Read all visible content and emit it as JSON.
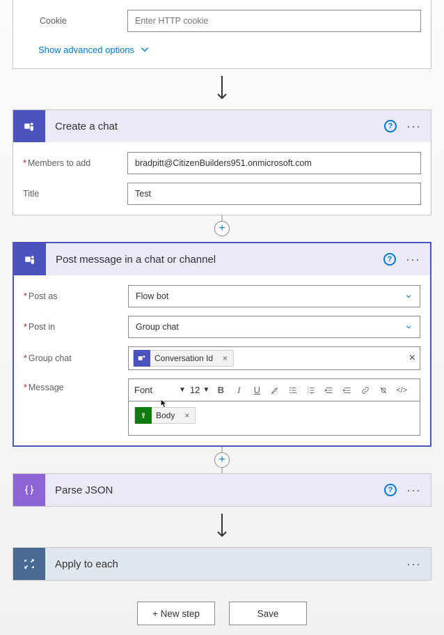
{
  "http_card": {
    "cookie_label": "Cookie",
    "cookie_placeholder": "Enter HTTP cookie",
    "advanced_link": "Show advanced options"
  },
  "create_chat": {
    "title": "Create a chat",
    "members_label": "Members to add",
    "members_value": "bradpitt@CitizenBuilders951.onmicrosoft.com",
    "title_label": "Title",
    "title_value": "Test"
  },
  "post_message": {
    "title": "Post message in a chat or channel",
    "post_as_label": "Post as",
    "post_as_value": "Flow bot",
    "post_in_label": "Post in",
    "post_in_value": "Group chat",
    "group_chat_label": "Group chat",
    "group_chat_token": "Conversation Id",
    "message_label": "Message",
    "rte_font_label": "Font",
    "rte_font_size": "12",
    "body_token": "Body"
  },
  "parse_json": {
    "title": "Parse JSON"
  },
  "apply_each": {
    "title": "Apply to each"
  },
  "buttons": {
    "new_step": "+ New step",
    "save": "Save"
  }
}
